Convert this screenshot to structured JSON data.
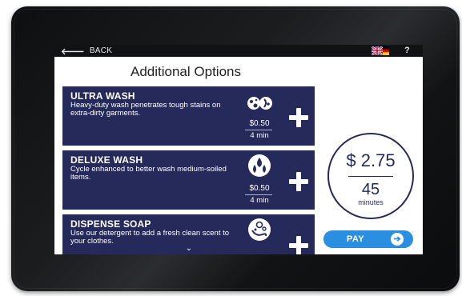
{
  "topbar": {
    "back_arrow": "🡐",
    "back_label": "BACK",
    "flag_icon": "uk-germany-flag-icon",
    "help_label": "?"
  },
  "page": {
    "title": "Additional Options"
  },
  "options": [
    {
      "name": "ULTRA WASH",
      "description": "Heavy-duty wash penetrates tough stains on extra-dirty garments.",
      "price": "$0.50",
      "time": "4 min",
      "icon": "stain-drops-icon"
    },
    {
      "name": "DELUXE WASH",
      "description": "Cycle enhanced to better wash medium-soiled items.",
      "price": "$0.50",
      "time": "4 min",
      "icon": "water-drops-icon"
    },
    {
      "name": "DISPENSE SOAP",
      "description": "Use our detergent to add a fresh clean scent to your clothes.",
      "price": "",
      "time": "",
      "icon": "soap-bubbles-icon"
    }
  ],
  "scroll": {
    "chevron": "⌄"
  },
  "summary": {
    "total_price": "$ 2.75",
    "total_minutes": "45",
    "minutes_label": "minutes"
  },
  "pay": {
    "label": "PAY",
    "arrow": "➔"
  },
  "colors": {
    "card": "#262a5b",
    "accent": "#2a8fe0"
  }
}
